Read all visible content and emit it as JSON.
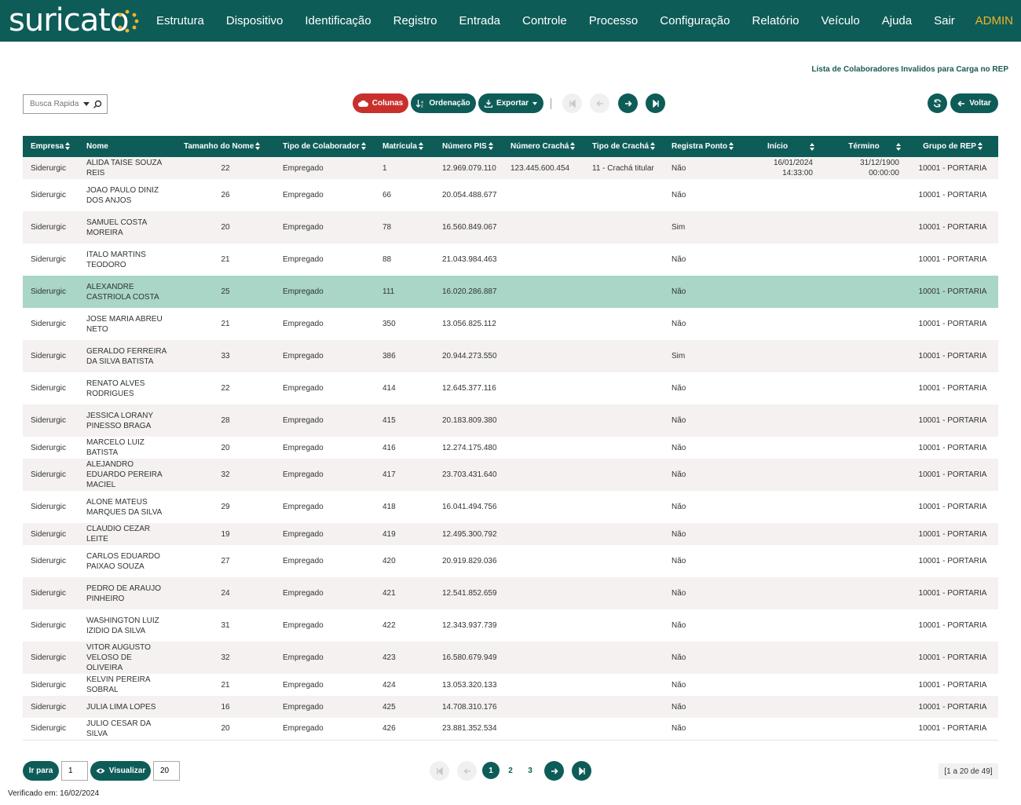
{
  "header": {
    "logo": "suricato",
    "nav": [
      "Estrutura",
      "Dispositivo",
      "Identificação",
      "Registro",
      "Entrada",
      "Controle",
      "Processo",
      "Configuração",
      "Relatório",
      "Veículo",
      "Ajuda",
      "Sair"
    ],
    "user": "ADMIN"
  },
  "page_title": "Lista de Colaboradores Invalidos para Carga no REP",
  "toolbar": {
    "search_placeholder": "Busca Rapida",
    "columns_label": "Colunas",
    "order_label": "Ordenação",
    "export_label": "Exportar",
    "back_label": "Voltar"
  },
  "table": {
    "headers": [
      "Empresa",
      "Nome",
      "Tamanho do Nome",
      "Tipo de Colaborador",
      "Matrícula",
      "Número PIS",
      "Número Crachá",
      "Tipo de Crachá",
      "Registra Ponto",
      "Início",
      "Término",
      "Grupo de REP"
    ],
    "rows": [
      {
        "empresa": "Siderurgic",
        "nome": "ALIDA TAISE SOUZA REIS",
        "tamanho": "22",
        "tipo": "Empregado",
        "matricula": "1",
        "pis": "12.969.079.110",
        "cracha": "123.445.600.454",
        "tipo_cracha": "11 - Crachá titular",
        "registra": "Não",
        "inicio": "16/01/2024 14:33:00",
        "termino": "31/12/1900 00:00:00",
        "grupo": "10001 - PORTARIA"
      },
      {
        "empresa": "Siderurgic",
        "nome": "JOAO PAULO DINIZ DOS ANJOS",
        "tamanho": "26",
        "tipo": "Empregado",
        "matricula": "66",
        "pis": "20.054.488.677",
        "cracha": "",
        "tipo_cracha": "",
        "registra": "Não",
        "inicio": "",
        "termino": "",
        "grupo": "10001 - PORTARIA"
      },
      {
        "empresa": "Siderurgic",
        "nome": "SAMUEL COSTA MOREIRA",
        "tamanho": "20",
        "tipo": "Empregado",
        "matricula": "78",
        "pis": "16.560.849.067",
        "cracha": "",
        "tipo_cracha": "",
        "registra": "Sim",
        "inicio": "",
        "termino": "",
        "grupo": "10001 - PORTARIA"
      },
      {
        "empresa": "Siderurgic",
        "nome": "ITALO MARTINS TEODORO",
        "tamanho": "21",
        "tipo": "Empregado",
        "matricula": "88",
        "pis": "21.043.984.463",
        "cracha": "",
        "tipo_cracha": "",
        "registra": "Não",
        "inicio": "",
        "termino": "",
        "grupo": "10001 - PORTARIA"
      },
      {
        "empresa": "Siderurgic",
        "nome": "ALEXANDRE CASTRIOLA COSTA",
        "tamanho": "25",
        "tipo": "Empregado",
        "matricula": "111",
        "pis": "16.020.286.887",
        "cracha": "",
        "tipo_cracha": "",
        "registra": "Não",
        "inicio": "",
        "termino": "",
        "grupo": "10001 - PORTARIA"
      },
      {
        "empresa": "Siderurgic",
        "nome": "JOSE MARIA ABREU NETO",
        "tamanho": "21",
        "tipo": "Empregado",
        "matricula": "350",
        "pis": "13.056.825.112",
        "cracha": "",
        "tipo_cracha": "",
        "registra": "Não",
        "inicio": "",
        "termino": "",
        "grupo": "10001 - PORTARIA"
      },
      {
        "empresa": "Siderurgic",
        "nome": "GERALDO FERREIRA DA SILVA BATISTA",
        "tamanho": "33",
        "tipo": "Empregado",
        "matricula": "386",
        "pis": "20.944.273.550",
        "cracha": "",
        "tipo_cracha": "",
        "registra": "Sim",
        "inicio": "",
        "termino": "",
        "grupo": "10001 - PORTARIA"
      },
      {
        "empresa": "Siderurgic",
        "nome": "RENATO ALVES RODRIGUES",
        "tamanho": "22",
        "tipo": "Empregado",
        "matricula": "414",
        "pis": "12.645.377.116",
        "cracha": "",
        "tipo_cracha": "",
        "registra": "Não",
        "inicio": "",
        "termino": "",
        "grupo": "10001 - PORTARIA"
      },
      {
        "empresa": "Siderurgic",
        "nome": "JESSICA LORANY PINESSO BRAGA",
        "tamanho": "28",
        "tipo": "Empregado",
        "matricula": "415",
        "pis": "20.183.809.380",
        "cracha": "",
        "tipo_cracha": "",
        "registra": "Não",
        "inicio": "",
        "termino": "",
        "grupo": "10001 - PORTARIA"
      },
      {
        "empresa": "Siderurgic",
        "nome": "MARCELO LUIZ BATISTA",
        "tamanho": "20",
        "tipo": "Empregado",
        "matricula": "416",
        "pis": "12.274.175.480",
        "cracha": "",
        "tipo_cracha": "",
        "registra": "Não",
        "inicio": "",
        "termino": "",
        "grupo": "10001 - PORTARIA"
      },
      {
        "empresa": "Siderurgic",
        "nome": "ALEJANDRO EDUARDO PEREIRA MACIEL",
        "tamanho": "32",
        "tipo": "Empregado",
        "matricula": "417",
        "pis": "23.703.431.640",
        "cracha": "",
        "tipo_cracha": "",
        "registra": "Não",
        "inicio": "",
        "termino": "",
        "grupo": "10001 - PORTARIA"
      },
      {
        "empresa": "Siderurgic",
        "nome": "ALONE MATEUS MARQUES DA SILVA",
        "tamanho": "29",
        "tipo": "Empregado",
        "matricula": "418",
        "pis": "16.041.494.756",
        "cracha": "",
        "tipo_cracha": "",
        "registra": "Não",
        "inicio": "",
        "termino": "",
        "grupo": "10001 - PORTARIA"
      },
      {
        "empresa": "Siderurgic",
        "nome": "CLAUDIO CEZAR LEITE",
        "tamanho": "19",
        "tipo": "Empregado",
        "matricula": "419",
        "pis": "12.495.300.792",
        "cracha": "",
        "tipo_cracha": "",
        "registra": "Não",
        "inicio": "",
        "termino": "",
        "grupo": "10001 - PORTARIA"
      },
      {
        "empresa": "Siderurgic",
        "nome": "CARLOS EDUARDO PAIXAO SOUZA",
        "tamanho": "27",
        "tipo": "Empregado",
        "matricula": "420",
        "pis": "20.919.829.036",
        "cracha": "",
        "tipo_cracha": "",
        "registra": "Não",
        "inicio": "",
        "termino": "",
        "grupo": "10001 - PORTARIA"
      },
      {
        "empresa": "Siderurgic",
        "nome": "PEDRO DE ARAUJO PINHEIRO",
        "tamanho": "24",
        "tipo": "Empregado",
        "matricula": "421",
        "pis": "12.541.852.659",
        "cracha": "",
        "tipo_cracha": "",
        "registra": "Não",
        "inicio": "",
        "termino": "",
        "grupo": "10001 - PORTARIA"
      },
      {
        "empresa": "Siderurgic",
        "nome": "WASHINGTON LUIZ IZIDIO DA SILVA",
        "tamanho": "31",
        "tipo": "Empregado",
        "matricula": "422",
        "pis": "12.343.937.739",
        "cracha": "",
        "tipo_cracha": "",
        "registra": "Não",
        "inicio": "",
        "termino": "",
        "grupo": "10001 - PORTARIA"
      },
      {
        "empresa": "Siderurgic",
        "nome": "VITOR AUGUSTO VELOSO DE OLIVEIRA",
        "tamanho": "32",
        "tipo": "Empregado",
        "matricula": "423",
        "pis": "16.580.679.949",
        "cracha": "",
        "tipo_cracha": "",
        "registra": "Não",
        "inicio": "",
        "termino": "",
        "grupo": "10001 - PORTARIA"
      },
      {
        "empresa": "Siderurgic",
        "nome": "KELVIN PEREIRA SOBRAL",
        "tamanho": "21",
        "tipo": "Empregado",
        "matricula": "424",
        "pis": "13.053.320.133",
        "cracha": "",
        "tipo_cracha": "",
        "registra": "Não",
        "inicio": "",
        "termino": "",
        "grupo": "10001 - PORTARIA"
      },
      {
        "empresa": "Siderurgic",
        "nome": "JULIA LIMA LOPES",
        "tamanho": "16",
        "tipo": "Empregado",
        "matricula": "425",
        "pis": "14.708.310.176",
        "cracha": "",
        "tipo_cracha": "",
        "registra": "Não",
        "inicio": "",
        "termino": "",
        "grupo": "10001 - PORTARIA"
      },
      {
        "empresa": "Siderurgic",
        "nome": "JULIO CESAR DA SILVA",
        "tamanho": "20",
        "tipo": "Empregado",
        "matricula": "426",
        "pis": "23.881.352.534",
        "cracha": "",
        "tipo_cracha": "",
        "registra": "Não",
        "inicio": "",
        "termino": "",
        "grupo": "10001 - PORTARIA"
      }
    ]
  },
  "footer": {
    "goto_label": "Ir para",
    "goto_value": "1",
    "view_label": "Visualizar",
    "view_value": "20",
    "pages": [
      "1",
      "2",
      "3"
    ],
    "current_page": "1",
    "range": "[1 a 20 de 49]",
    "verified": "Verificado em: 16/02/2024"
  },
  "colors": {
    "primary": "#0e5c58",
    "danger": "#c9302c",
    "accent": "#f0b429",
    "row_selected": "#a9d6c7"
  }
}
